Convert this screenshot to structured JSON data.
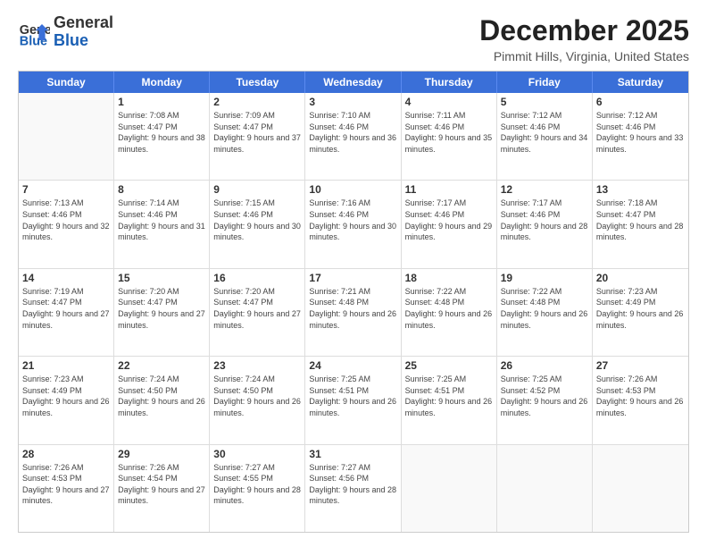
{
  "header": {
    "logo_line1": "General",
    "logo_line2": "Blue",
    "month": "December 2025",
    "location": "Pimmit Hills, Virginia, United States"
  },
  "days_of_week": [
    "Sunday",
    "Monday",
    "Tuesday",
    "Wednesday",
    "Thursday",
    "Friday",
    "Saturday"
  ],
  "weeks": [
    [
      {
        "day": "",
        "sunrise": "",
        "sunset": "",
        "daylight": ""
      },
      {
        "day": "1",
        "sunrise": "Sunrise: 7:08 AM",
        "sunset": "Sunset: 4:47 PM",
        "daylight": "Daylight: 9 hours and 38 minutes."
      },
      {
        "day": "2",
        "sunrise": "Sunrise: 7:09 AM",
        "sunset": "Sunset: 4:47 PM",
        "daylight": "Daylight: 9 hours and 37 minutes."
      },
      {
        "day": "3",
        "sunrise": "Sunrise: 7:10 AM",
        "sunset": "Sunset: 4:46 PM",
        "daylight": "Daylight: 9 hours and 36 minutes."
      },
      {
        "day": "4",
        "sunrise": "Sunrise: 7:11 AM",
        "sunset": "Sunset: 4:46 PM",
        "daylight": "Daylight: 9 hours and 35 minutes."
      },
      {
        "day": "5",
        "sunrise": "Sunrise: 7:12 AM",
        "sunset": "Sunset: 4:46 PM",
        "daylight": "Daylight: 9 hours and 34 minutes."
      },
      {
        "day": "6",
        "sunrise": "Sunrise: 7:12 AM",
        "sunset": "Sunset: 4:46 PM",
        "daylight": "Daylight: 9 hours and 33 minutes."
      }
    ],
    [
      {
        "day": "7",
        "sunrise": "Sunrise: 7:13 AM",
        "sunset": "Sunset: 4:46 PM",
        "daylight": "Daylight: 9 hours and 32 minutes."
      },
      {
        "day": "8",
        "sunrise": "Sunrise: 7:14 AM",
        "sunset": "Sunset: 4:46 PM",
        "daylight": "Daylight: 9 hours and 31 minutes."
      },
      {
        "day": "9",
        "sunrise": "Sunrise: 7:15 AM",
        "sunset": "Sunset: 4:46 PM",
        "daylight": "Daylight: 9 hours and 30 minutes."
      },
      {
        "day": "10",
        "sunrise": "Sunrise: 7:16 AM",
        "sunset": "Sunset: 4:46 PM",
        "daylight": "Daylight: 9 hours and 30 minutes."
      },
      {
        "day": "11",
        "sunrise": "Sunrise: 7:17 AM",
        "sunset": "Sunset: 4:46 PM",
        "daylight": "Daylight: 9 hours and 29 minutes."
      },
      {
        "day": "12",
        "sunrise": "Sunrise: 7:17 AM",
        "sunset": "Sunset: 4:46 PM",
        "daylight": "Daylight: 9 hours and 28 minutes."
      },
      {
        "day": "13",
        "sunrise": "Sunrise: 7:18 AM",
        "sunset": "Sunset: 4:47 PM",
        "daylight": "Daylight: 9 hours and 28 minutes."
      }
    ],
    [
      {
        "day": "14",
        "sunrise": "Sunrise: 7:19 AM",
        "sunset": "Sunset: 4:47 PM",
        "daylight": "Daylight: 9 hours and 27 minutes."
      },
      {
        "day": "15",
        "sunrise": "Sunrise: 7:20 AM",
        "sunset": "Sunset: 4:47 PM",
        "daylight": "Daylight: 9 hours and 27 minutes."
      },
      {
        "day": "16",
        "sunrise": "Sunrise: 7:20 AM",
        "sunset": "Sunset: 4:47 PM",
        "daylight": "Daylight: 9 hours and 27 minutes."
      },
      {
        "day": "17",
        "sunrise": "Sunrise: 7:21 AM",
        "sunset": "Sunset: 4:48 PM",
        "daylight": "Daylight: 9 hours and 26 minutes."
      },
      {
        "day": "18",
        "sunrise": "Sunrise: 7:22 AM",
        "sunset": "Sunset: 4:48 PM",
        "daylight": "Daylight: 9 hours and 26 minutes."
      },
      {
        "day": "19",
        "sunrise": "Sunrise: 7:22 AM",
        "sunset": "Sunset: 4:48 PM",
        "daylight": "Daylight: 9 hours and 26 minutes."
      },
      {
        "day": "20",
        "sunrise": "Sunrise: 7:23 AM",
        "sunset": "Sunset: 4:49 PM",
        "daylight": "Daylight: 9 hours and 26 minutes."
      }
    ],
    [
      {
        "day": "21",
        "sunrise": "Sunrise: 7:23 AM",
        "sunset": "Sunset: 4:49 PM",
        "daylight": "Daylight: 9 hours and 26 minutes."
      },
      {
        "day": "22",
        "sunrise": "Sunrise: 7:24 AM",
        "sunset": "Sunset: 4:50 PM",
        "daylight": "Daylight: 9 hours and 26 minutes."
      },
      {
        "day": "23",
        "sunrise": "Sunrise: 7:24 AM",
        "sunset": "Sunset: 4:50 PM",
        "daylight": "Daylight: 9 hours and 26 minutes."
      },
      {
        "day": "24",
        "sunrise": "Sunrise: 7:25 AM",
        "sunset": "Sunset: 4:51 PM",
        "daylight": "Daylight: 9 hours and 26 minutes."
      },
      {
        "day": "25",
        "sunrise": "Sunrise: 7:25 AM",
        "sunset": "Sunset: 4:51 PM",
        "daylight": "Daylight: 9 hours and 26 minutes."
      },
      {
        "day": "26",
        "sunrise": "Sunrise: 7:25 AM",
        "sunset": "Sunset: 4:52 PM",
        "daylight": "Daylight: 9 hours and 26 minutes."
      },
      {
        "day": "27",
        "sunrise": "Sunrise: 7:26 AM",
        "sunset": "Sunset: 4:53 PM",
        "daylight": "Daylight: 9 hours and 26 minutes."
      }
    ],
    [
      {
        "day": "28",
        "sunrise": "Sunrise: 7:26 AM",
        "sunset": "Sunset: 4:53 PM",
        "daylight": "Daylight: 9 hours and 27 minutes."
      },
      {
        "day": "29",
        "sunrise": "Sunrise: 7:26 AM",
        "sunset": "Sunset: 4:54 PM",
        "daylight": "Daylight: 9 hours and 27 minutes."
      },
      {
        "day": "30",
        "sunrise": "Sunrise: 7:27 AM",
        "sunset": "Sunset: 4:55 PM",
        "daylight": "Daylight: 9 hours and 28 minutes."
      },
      {
        "day": "31",
        "sunrise": "Sunrise: 7:27 AM",
        "sunset": "Sunset: 4:56 PM",
        "daylight": "Daylight: 9 hours and 28 minutes."
      },
      {
        "day": "",
        "sunrise": "",
        "sunset": "",
        "daylight": ""
      },
      {
        "day": "",
        "sunrise": "",
        "sunset": "",
        "daylight": ""
      },
      {
        "day": "",
        "sunrise": "",
        "sunset": "",
        "daylight": ""
      }
    ]
  ]
}
